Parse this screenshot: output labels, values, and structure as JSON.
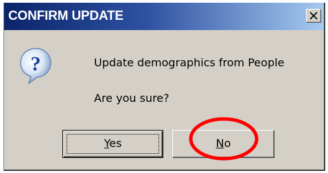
{
  "dialog": {
    "title": "CONFIRM UPDATE",
    "close_icon": "close-icon",
    "icon": "question-icon",
    "message_line1": "Update demographics from People",
    "message_line2": "Are you sure?",
    "buttons": {
      "yes": {
        "mnemonic": "Y",
        "rest": "es"
      },
      "no": {
        "mnemonic": "N",
        "rest": "o"
      }
    }
  },
  "annotation": {
    "shape": "ellipse",
    "target": "no-button",
    "color": "#ff0000"
  },
  "colors": {
    "title_gradient_start": "#0a246a",
    "title_gradient_end": "#a6caf0",
    "dialog_face": "#d4d0c8"
  }
}
